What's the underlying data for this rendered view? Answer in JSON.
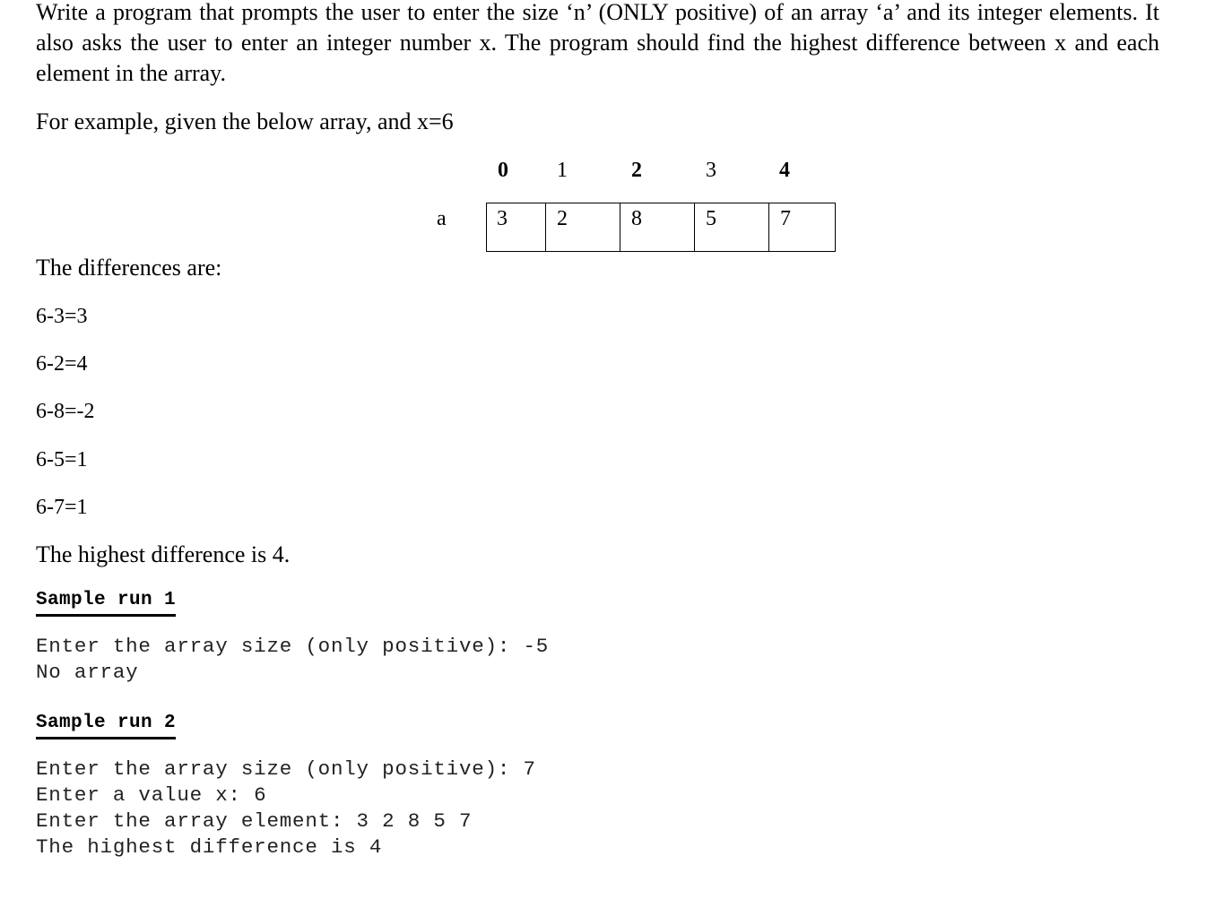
{
  "problem": {
    "intro": "Write a program that prompts the user to enter the size ‘n’ (ONLY positive) of an array ‘a’ and its integer elements. It also asks the user to enter an integer number x. The program should find the highest difference between x and each element in the array.",
    "example": "For example, given the below array, and x=6"
  },
  "array_figure": {
    "name": "a",
    "indices": [
      "0",
      "1",
      "2",
      "3",
      "4"
    ],
    "values": [
      "3",
      "2",
      "8",
      "5",
      "7"
    ]
  },
  "differences": {
    "heading": "The differences are:",
    "lines": [
      "6-3=3",
      "6-2=4",
      "6-8=-2",
      "6-5=1",
      "6-7=1"
    ],
    "conclusion": "The highest difference is 4."
  },
  "sample_runs": [
    {
      "title": "Sample run 1",
      "lines": [
        "Enter the array size (only positive): -5",
        "No array"
      ]
    },
    {
      "title": "Sample run 2",
      "lines": [
        "Enter the array size (only positive): 7",
        "Enter a value x: 6",
        "Enter the array element: 3 2 8 5 7",
        "The highest difference is 4"
      ]
    }
  ]
}
